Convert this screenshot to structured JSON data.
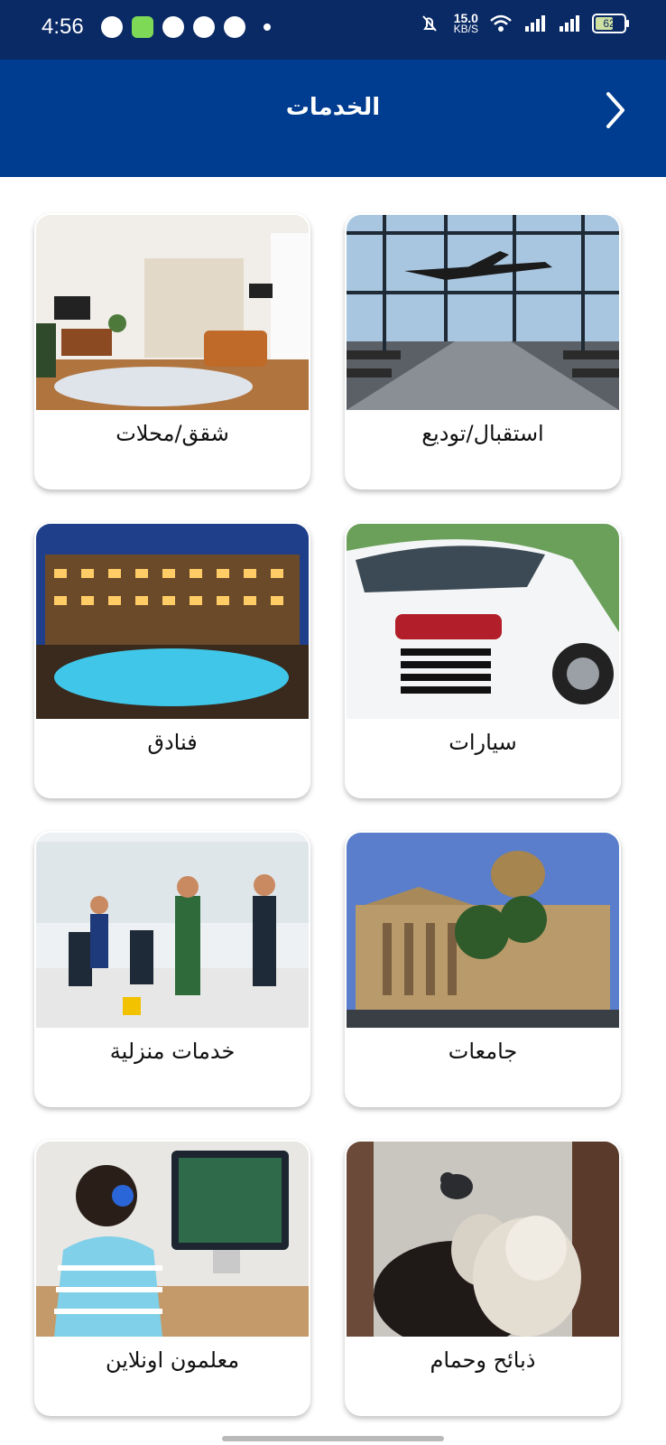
{
  "status_bar": {
    "time": "4:56",
    "net_speed_value": "15.0",
    "net_speed_unit": "KB/S",
    "battery": "62",
    "battery_level": 0.62,
    "icons": [
      "whatsapp-icon",
      "messages-icon",
      "tiktok-icon",
      "viber-icon",
      "pinwheel-icon",
      "notification-dot-icon",
      "mute-icon",
      "wifi-icon",
      "signal-icon",
      "signal-icon",
      "battery-icon"
    ]
  },
  "header": {
    "title": "الخدمات",
    "back_icon": "chevron-right-icon",
    "background": "#003c8f"
  },
  "services": [
    {
      "label": "استقبال/توديع",
      "image": "airport-terminal-photo"
    },
    {
      "label": "شقق/محلات",
      "image": "apartment-living-room-photo"
    },
    {
      "label": "سيارات",
      "image": "white-sports-car-photo"
    },
    {
      "label": "فنادق",
      "image": "hotel-pool-night-photo"
    },
    {
      "label": "جامعات",
      "image": "university-building-photo"
    },
    {
      "label": "خدمات منزلية",
      "image": "cleaning-staff-photo"
    },
    {
      "label": "ذبائح وحمام",
      "image": "sheep-and-pigeon-photo"
    },
    {
      "label": "معلمون اونلاين",
      "image": "child-online-class-photo"
    }
  ]
}
